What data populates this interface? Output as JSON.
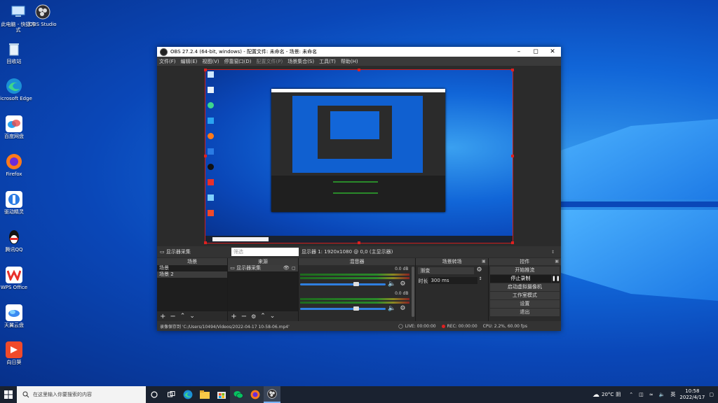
{
  "desktop_icons": [
    {
      "label": "此电脑 - 快捷方式",
      "name": "this-pc"
    },
    {
      "label": "OBS Studio",
      "name": "obs-studio"
    },
    {
      "label": "回收站",
      "name": "recycle-bin"
    },
    {
      "label": "Microsoft Edge",
      "name": "microsoft-edge"
    },
    {
      "label": "百度网盘",
      "name": "baidu-netdisk"
    },
    {
      "label": "Firefox",
      "name": "firefox"
    },
    {
      "label": "驱动精灵",
      "name": "driver-genius"
    },
    {
      "label": "腾讯QQ",
      "name": "tencent-qq"
    },
    {
      "label": "WPS Office",
      "name": "wps-office"
    },
    {
      "label": "天翼云盘",
      "name": "tianyi-cloud"
    },
    {
      "label": "向日葵",
      "name": "sunlogin"
    }
  ],
  "obs": {
    "title": "OBS 27.2.4 (64-bit, windows) - 配置文件: 未命名 - 场景: 未命名",
    "menu": [
      {
        "label": "文件(F)",
        "disabled": false
      },
      {
        "label": "编辑(E)",
        "disabled": false
      },
      {
        "label": "视图(V)",
        "disabled": false
      },
      {
        "label": "停靠窗口(D)",
        "disabled": false
      },
      {
        "label": "配置文件(P)",
        "disabled": true
      },
      {
        "label": "场景集合(S)",
        "disabled": false
      },
      {
        "label": "工具(T)",
        "disabled": false
      },
      {
        "label": "帮助(H)",
        "disabled": false
      }
    ],
    "source_bar": {
      "source_name": "显示器采集",
      "filter_placeholder": "筛选",
      "display_info": "显示器 1: 1920x1080 @ 0,0 (主显示器)"
    },
    "scenes": {
      "header": "场景",
      "items": [
        "场景",
        "场景 2"
      ]
    },
    "sources": {
      "header": "来源",
      "items": [
        "显示器采集"
      ]
    },
    "mixer": {
      "header": "混音器",
      "channels": [
        {
          "db": "0.0 dB",
          "level": 0.62
        },
        {
          "db": "0.0 dB",
          "level": 0.62
        }
      ]
    },
    "transitions": {
      "header": "场景转场",
      "type": "渐变",
      "duration_label": "时长",
      "duration": "300 ms"
    },
    "controls": {
      "header": "控件",
      "start_streaming": "开始推流",
      "stop_recording": "停止录制",
      "virtual_camera": "启动虚拟摄像机",
      "studio_mode": "工作室模式",
      "settings": "设置",
      "exit": "退出"
    },
    "status": {
      "recording_path": "录像保存到 'C:/Users/10494/Videos/2022-04-17 10-58-06.mp4'",
      "live": "LIVE: 00:00:00",
      "rec": "REC: 00:00:00",
      "cpu": "CPU: 2.2%, 60.00 fps"
    }
  },
  "taskbar": {
    "search_placeholder": "在这里输入你要搜索的内容",
    "weather": "20°C",
    "weather_text": "阴",
    "ime": "英",
    "time": "10:58",
    "date": "2022/4/17"
  },
  "colors": {
    "accent_red": "#e02020",
    "obs_bg": "#2b2b2b",
    "slider_blue": "#2f7fe0",
    "taskbar": "#1a2230"
  }
}
